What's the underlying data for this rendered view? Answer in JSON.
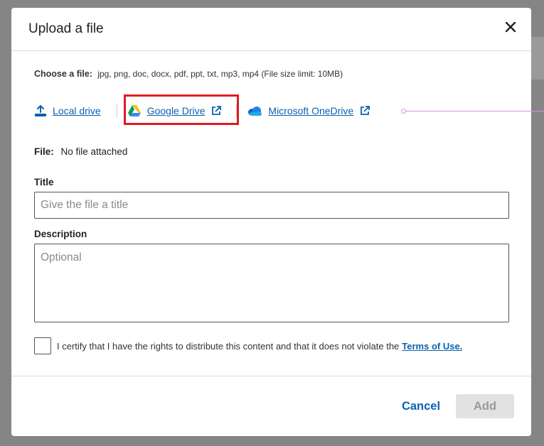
{
  "dialog": {
    "title": "Upload a file",
    "close_icon": "close-icon"
  },
  "choose": {
    "label": "Choose a file:",
    "formats": "jpg, png, doc, docx, pdf, ppt, txt, mp3, mp4 (File size limit: 10MB)"
  },
  "sources": [
    {
      "label": "Local drive",
      "icon": "upload-icon"
    },
    {
      "label": "Google Drive",
      "icon": "google-drive-icon",
      "trailing_icon": "external-link-icon"
    },
    {
      "label": "Microsoft OneDrive",
      "icon": "onedrive-cloud-icon",
      "trailing_icon": "external-link-icon"
    }
  ],
  "file": {
    "label": "File:",
    "value": "No file attached"
  },
  "title_field": {
    "label": "Title",
    "placeholder": "Give the file a title",
    "value": ""
  },
  "description_field": {
    "label": "Description",
    "placeholder": "Optional",
    "value": ""
  },
  "certify": {
    "text": "I certify that I have the rights to distribute this content and that it does not violate the",
    "link": "Terms of Use.",
    "checked": false
  },
  "footer": {
    "cancel_label": "Cancel",
    "add_label": "Add"
  },
  "colors": {
    "link": "#0b62b0",
    "highlight_box": "#e01b24",
    "annotation": "#e58ae0",
    "disabled_button": "#e2e2e2"
  }
}
